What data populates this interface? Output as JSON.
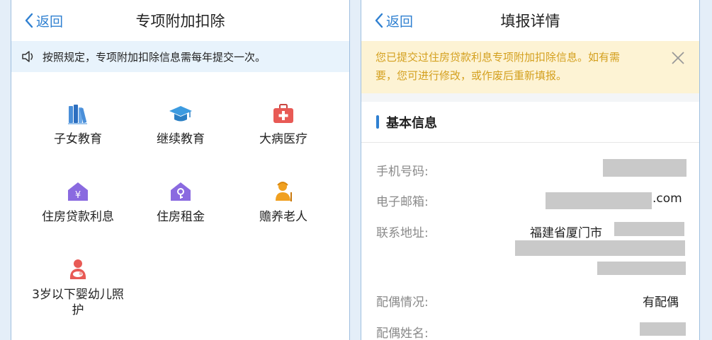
{
  "left": {
    "back_label": "返回",
    "title": "专项附加扣除",
    "notice": "按照规定，专项附加扣除信息需每年提交一次。",
    "categories": [
      {
        "label": "子女教育",
        "icon": "books-icon",
        "color": "#4a8fd9"
      },
      {
        "label": "继续教育",
        "icon": "graduation-cap-icon",
        "color": "#3c9be0"
      },
      {
        "label": "大病医疗",
        "icon": "medical-kit-icon",
        "color": "#e85a55"
      },
      {
        "label": "住房贷款利息",
        "icon": "house-loan-icon",
        "color": "#8a6ae0"
      },
      {
        "label": "住房租金",
        "icon": "house-rent-icon",
        "color": "#8a6ae0"
      },
      {
        "label": "赡养老人",
        "icon": "elderly-icon",
        "color": "#f0a020"
      },
      {
        "label": "3岁以下婴幼儿照",
        "label2": "护",
        "icon": "infant-care-icon",
        "color": "#e85a55"
      }
    ]
  },
  "right": {
    "back_label": "返回",
    "title": "填报详情",
    "alert_line1": "您已提交过住房贷款利息专项附加扣除信息。如有需",
    "alert_line2": "要，您可进行修改，或作废后重新填报。",
    "section_title": "基本信息",
    "fields": {
      "phone_label": "手机号码:",
      "email_label": "电子邮箱:",
      "email_suffix": ".com",
      "address_label": "联系地址:",
      "address_value": "福建省厦门市",
      "spouse_status_label": "配偶情况:",
      "spouse_status_value": "有配偶",
      "spouse_name_label": "配偶姓名:"
    }
  },
  "colors": {
    "accent": "#2f80d1",
    "alert_text": "#d4a01f",
    "alert_bg": "#fdf3d4",
    "notice_bg": "#e8f3fc"
  }
}
